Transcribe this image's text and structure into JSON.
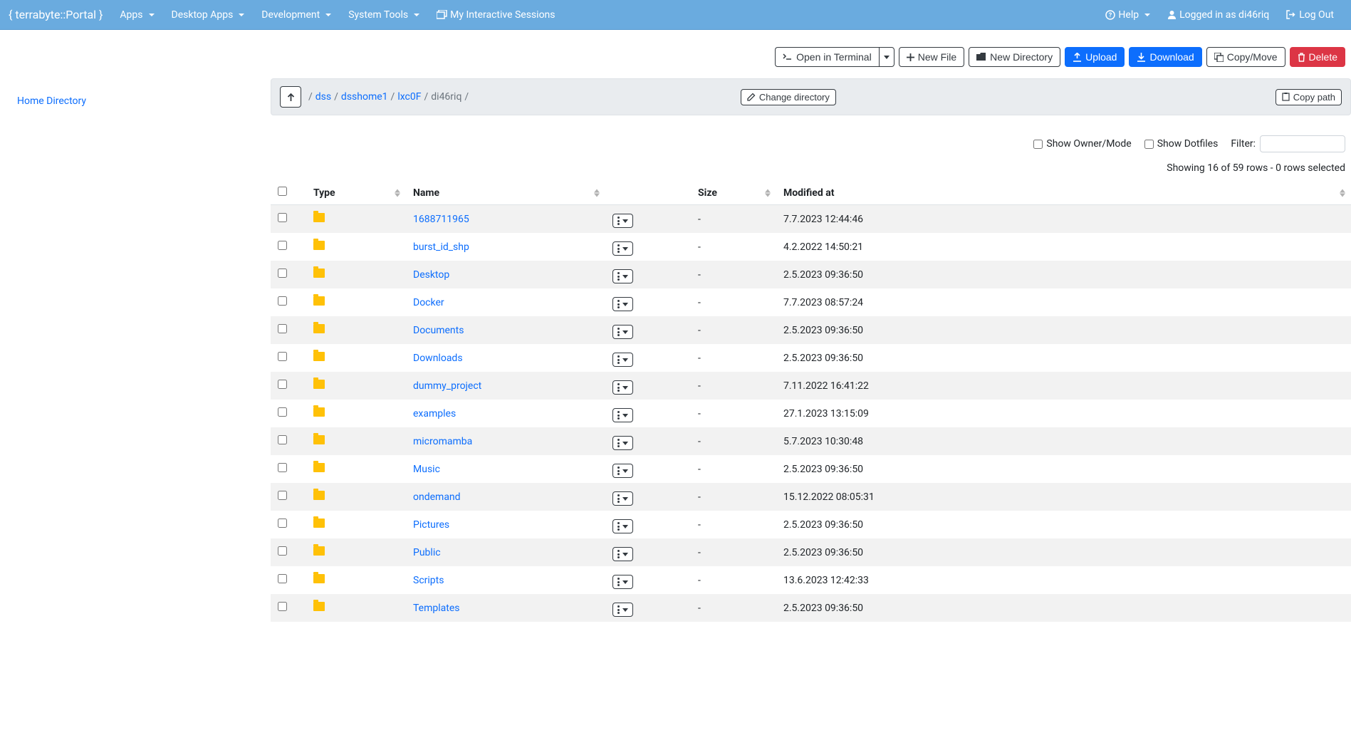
{
  "navbar": {
    "brand": "{ terrabyte::Portal }",
    "links": [
      {
        "label": "Apps",
        "dropdown": true
      },
      {
        "label": "Desktop Apps",
        "dropdown": true
      },
      {
        "label": "Development",
        "dropdown": true
      },
      {
        "label": "System Tools",
        "dropdown": true
      }
    ],
    "sessions_label": "My Interactive Sessions",
    "help_label": "Help",
    "logged_in_label": "Logged in as di46riq",
    "logout_label": "Log Out"
  },
  "sidebar": {
    "home_label": "Home Directory"
  },
  "toolbar": {
    "open_terminal": "Open in Terminal",
    "new_file": "New File",
    "new_directory": "New Directory",
    "upload": "Upload",
    "download": "Download",
    "copy_move": "Copy/Move",
    "delete": "Delete"
  },
  "breadcrumb": {
    "parts": [
      "dss",
      "dsshome1",
      "lxc0F",
      "di46riq"
    ],
    "change_dir": "Change directory",
    "copy_path": "Copy path"
  },
  "options": {
    "show_owner": "Show Owner/Mode",
    "show_dotfiles": "Show Dotfiles",
    "filter_label": "Filter:"
  },
  "status": {
    "text": "Showing 16 of 59 rows - 0 rows selected"
  },
  "table": {
    "headers": {
      "type": "Type",
      "name": "Name",
      "size": "Size",
      "modified": "Modified at"
    },
    "rows": [
      {
        "name": "1688711965",
        "size": "-",
        "modified": "7.7.2023 12:44:46"
      },
      {
        "name": "burst_id_shp",
        "size": "-",
        "modified": "4.2.2022 14:50:21"
      },
      {
        "name": "Desktop",
        "size": "-",
        "modified": "2.5.2023 09:36:50"
      },
      {
        "name": "Docker",
        "size": "-",
        "modified": "7.7.2023 08:57:24"
      },
      {
        "name": "Documents",
        "size": "-",
        "modified": "2.5.2023 09:36:50"
      },
      {
        "name": "Downloads",
        "size": "-",
        "modified": "2.5.2023 09:36:50"
      },
      {
        "name": "dummy_project",
        "size": "-",
        "modified": "7.11.2022 16:41:22"
      },
      {
        "name": "examples",
        "size": "-",
        "modified": "27.1.2023 13:15:09"
      },
      {
        "name": "micromamba",
        "size": "-",
        "modified": "5.7.2023 10:30:48"
      },
      {
        "name": "Music",
        "size": "-",
        "modified": "2.5.2023 09:36:50"
      },
      {
        "name": "ondemand",
        "size": "-",
        "modified": "15.12.2022 08:05:31"
      },
      {
        "name": "Pictures",
        "size": "-",
        "modified": "2.5.2023 09:36:50"
      },
      {
        "name": "Public",
        "size": "-",
        "modified": "2.5.2023 09:36:50"
      },
      {
        "name": "Scripts",
        "size": "-",
        "modified": "13.6.2023 12:42:33"
      },
      {
        "name": "Templates",
        "size": "-",
        "modified": "2.5.2023 09:36:50"
      }
    ]
  }
}
